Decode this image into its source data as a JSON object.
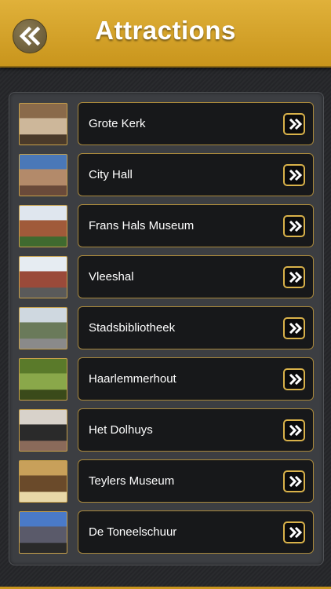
{
  "header": {
    "title": "Attractions",
    "back_icon": "double-chevron-left-icon"
  },
  "accent_color": "#d9b24a",
  "items": [
    {
      "label": "Grote Kerk",
      "thumb": "church-interior-photo",
      "colors": [
        "#8a6a4a",
        "#cdb79a",
        "#4a3a2a"
      ]
    },
    {
      "label": "City Hall",
      "thumb": "town-hall-photo",
      "colors": [
        "#4a78b8",
        "#b38a6a",
        "#6a4a3a"
      ]
    },
    {
      "label": "Frans Hals Museum",
      "thumb": "museum-building-photo",
      "colors": [
        "#dfe6ee",
        "#a05a3a",
        "#3f6a2f"
      ]
    },
    {
      "label": "Vleeshal",
      "thumb": "gabled-hall-photo",
      "colors": [
        "#e6ecf2",
        "#9a4a3a",
        "#5a5a5a"
      ]
    },
    {
      "label": "Stadsbibliotheek",
      "thumb": "library-photo",
      "colors": [
        "#cfd8e0",
        "#6a7a5a",
        "#8a8a8a"
      ]
    },
    {
      "label": "Haarlemmerhout",
      "thumb": "forest-photo",
      "colors": [
        "#5a7a2a",
        "#8aa84a",
        "#3a4a1a"
      ]
    },
    {
      "label": "Het Dolhuys",
      "thumb": "gallery-photo",
      "colors": [
        "#d8d2ca",
        "#2a2a2a",
        "#8a6a5a"
      ]
    },
    {
      "label": "Teylers Museum",
      "thumb": "museum-hall-photo",
      "colors": [
        "#c8a05a",
        "#6a4a2a",
        "#e8d8a8"
      ]
    },
    {
      "label": "De Toneelschuur",
      "thumb": "modern-building-photo",
      "colors": [
        "#4a7ac8",
        "#5a5a6a",
        "#2a2a2a"
      ]
    }
  ]
}
